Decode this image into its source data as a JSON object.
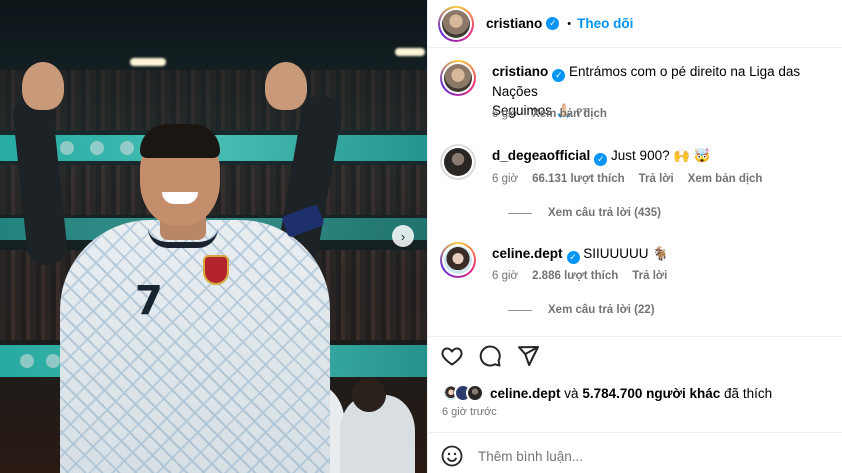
{
  "post": {
    "image_alt_icon": "image",
    "next_icon": "chevron-right-icon"
  },
  "header": {
    "username": "cristiano",
    "separator": "•",
    "follow_label": "Theo dõi"
  },
  "caption": {
    "username": "cristiano",
    "text": "Entrámos com o pé direito na Liga das Nações",
    "text2": "Seguimos",
    "emoji": "🙏🏻",
    "tag": "PT",
    "time": "6 giờ",
    "translate": "Xem bản dịch"
  },
  "comments": [
    {
      "username": "d_degeaofficial",
      "text": "Just 900? 🙌 🤯",
      "time": "6 giờ",
      "likes": "66.131 lượt thích",
      "reply": "Trả lời",
      "translate": "Xem bản dịch",
      "replies": "Xem câu trả lời (435)"
    },
    {
      "username": "celine.dept",
      "text": "SIIUUUUU 🐐",
      "time": "6 giờ",
      "likes": "2.886 lượt thích",
      "reply": "Trả lời",
      "replies": "Xem câu trả lời (22)"
    }
  ],
  "liked_by": {
    "name": "celine.dept",
    "joiner": "và",
    "others": "5.784.700 người khác",
    "suffix": "đã thích"
  },
  "timestamp": "6 giờ trước",
  "comment_input": {
    "placeholder": "Thêm bình luận..."
  },
  "colors": {
    "accent": "#0095f6",
    "muted": "#737373"
  }
}
